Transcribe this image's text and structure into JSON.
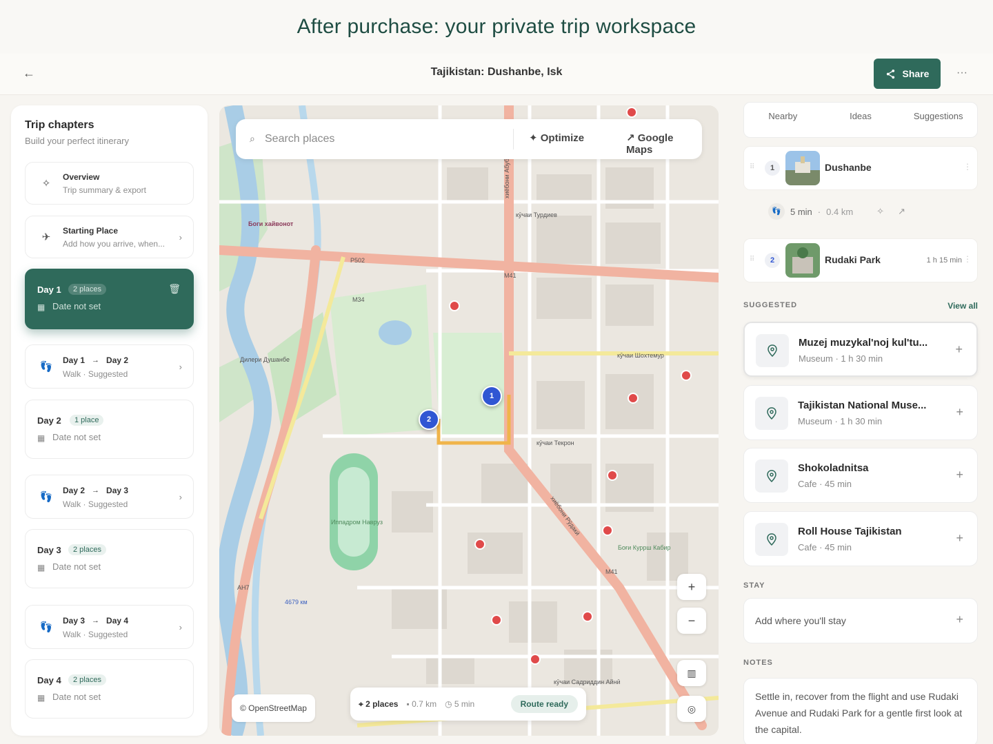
{
  "banner": {
    "text": "After purchase: your private trip workspace"
  },
  "topbar": {
    "back_icon": "arrow-left-icon",
    "title": "Tajikistan: Dushanbe, Isk",
    "share_label": "Share",
    "more_label": "···"
  },
  "left": {
    "title": "Trip chapters",
    "subtitle": "Build your perfect itinerary",
    "overview": {
      "title": "Overview",
      "sub": "Trip summary & export",
      "icon": "sparkles-icon"
    },
    "starting": {
      "title": "Starting Place",
      "sub": "Add how you arrive, when...",
      "icon": "plane-landing-icon"
    },
    "days": [
      {
        "label": "Day 1",
        "badge": "2 places",
        "date": "Date not set"
      },
      {
        "label": "Day 2",
        "badge": "1 place",
        "date": "Date not set"
      },
      {
        "label": "Day 3",
        "badge": "2 places",
        "date": "Date not set"
      },
      {
        "label": "Day 4",
        "badge": "2 places",
        "date": "Date not set"
      }
    ],
    "walks": [
      {
        "from": "Day 1",
        "to": "Day 2",
        "sub": "Walk · Suggested"
      },
      {
        "from": "Day 2",
        "to": "Day 3",
        "sub": "Walk · Suggested"
      },
      {
        "from": "Day 3",
        "to": "Day 4",
        "sub": "Walk · Suggested"
      }
    ]
  },
  "map": {
    "search_placeholder": "Search places",
    "optimize_label": "Optimize",
    "google_maps_label": "Google Maps",
    "attribution": "© OpenStreetMap",
    "zoom_in": "+",
    "zoom_out": "−",
    "route": {
      "places": "2 places",
      "distance": "0.7 km",
      "time": "5 min",
      "status": "Route ready"
    },
    "pins": [
      "1",
      "2"
    ],
    "labels": {
      "l1": "Боги хайвонот",
      "l2": "Р502",
      "l3": "М34",
      "l4": "М41",
      "l5": "АН7",
      "l6": "4679 км",
      "l7": "кӯчаи Шохтемур",
      "l8": "кӯчаи Текрон",
      "l9": "Иппадром Навруз",
      "l10": "хиёбони Рӯдакӣ",
      "l11": "М41",
      "l12": "кӯчаи Садриддин Айнӣ",
      "l13": "кӯчаи Турдиев",
      "l14": "Дилери Душанбе",
      "l15": "Боғи Куррш Кабир",
      "l16": "хиёбони Абубакр"
    }
  },
  "right": {
    "tabs": [
      "Nearby",
      "Ideas",
      "Suggestions"
    ],
    "stops": [
      {
        "num": "1",
        "name": "Dushanbe",
        "duration": ""
      },
      {
        "num": "2",
        "name": "Rudaki Park",
        "duration": "1 h 15 min"
      }
    ],
    "leg": {
      "time": "5 min",
      "sep": "·",
      "distance": "0.4 km"
    },
    "suggested_title": "SUGGESTED",
    "view_all": "View all",
    "suggestions": [
      {
        "name": "Muzej muzykal'noj kul'tu...",
        "meta": "Museum · 1 h 30 min"
      },
      {
        "name": "Tajikistan National Muse...",
        "meta": "Museum · 1 h 30 min"
      },
      {
        "name": "Shokoladnitsa",
        "meta": "Cafe · 45 min"
      },
      {
        "name": "Roll House Tajikistan",
        "meta": "Cafe · 45 min"
      }
    ],
    "stay_title": "STAY",
    "stay_placeholder": "Add where you'll stay",
    "notes_title": "NOTES",
    "notes_text": "Settle in, recover from the flight and use Rudaki Avenue and Rudaki Park for a gentle first look at the capital."
  },
  "colors": {
    "accent": "#2f6a5b",
    "pin": "#3056d3",
    "route": "#f0b44a",
    "road_major": "#e89b85"
  }
}
